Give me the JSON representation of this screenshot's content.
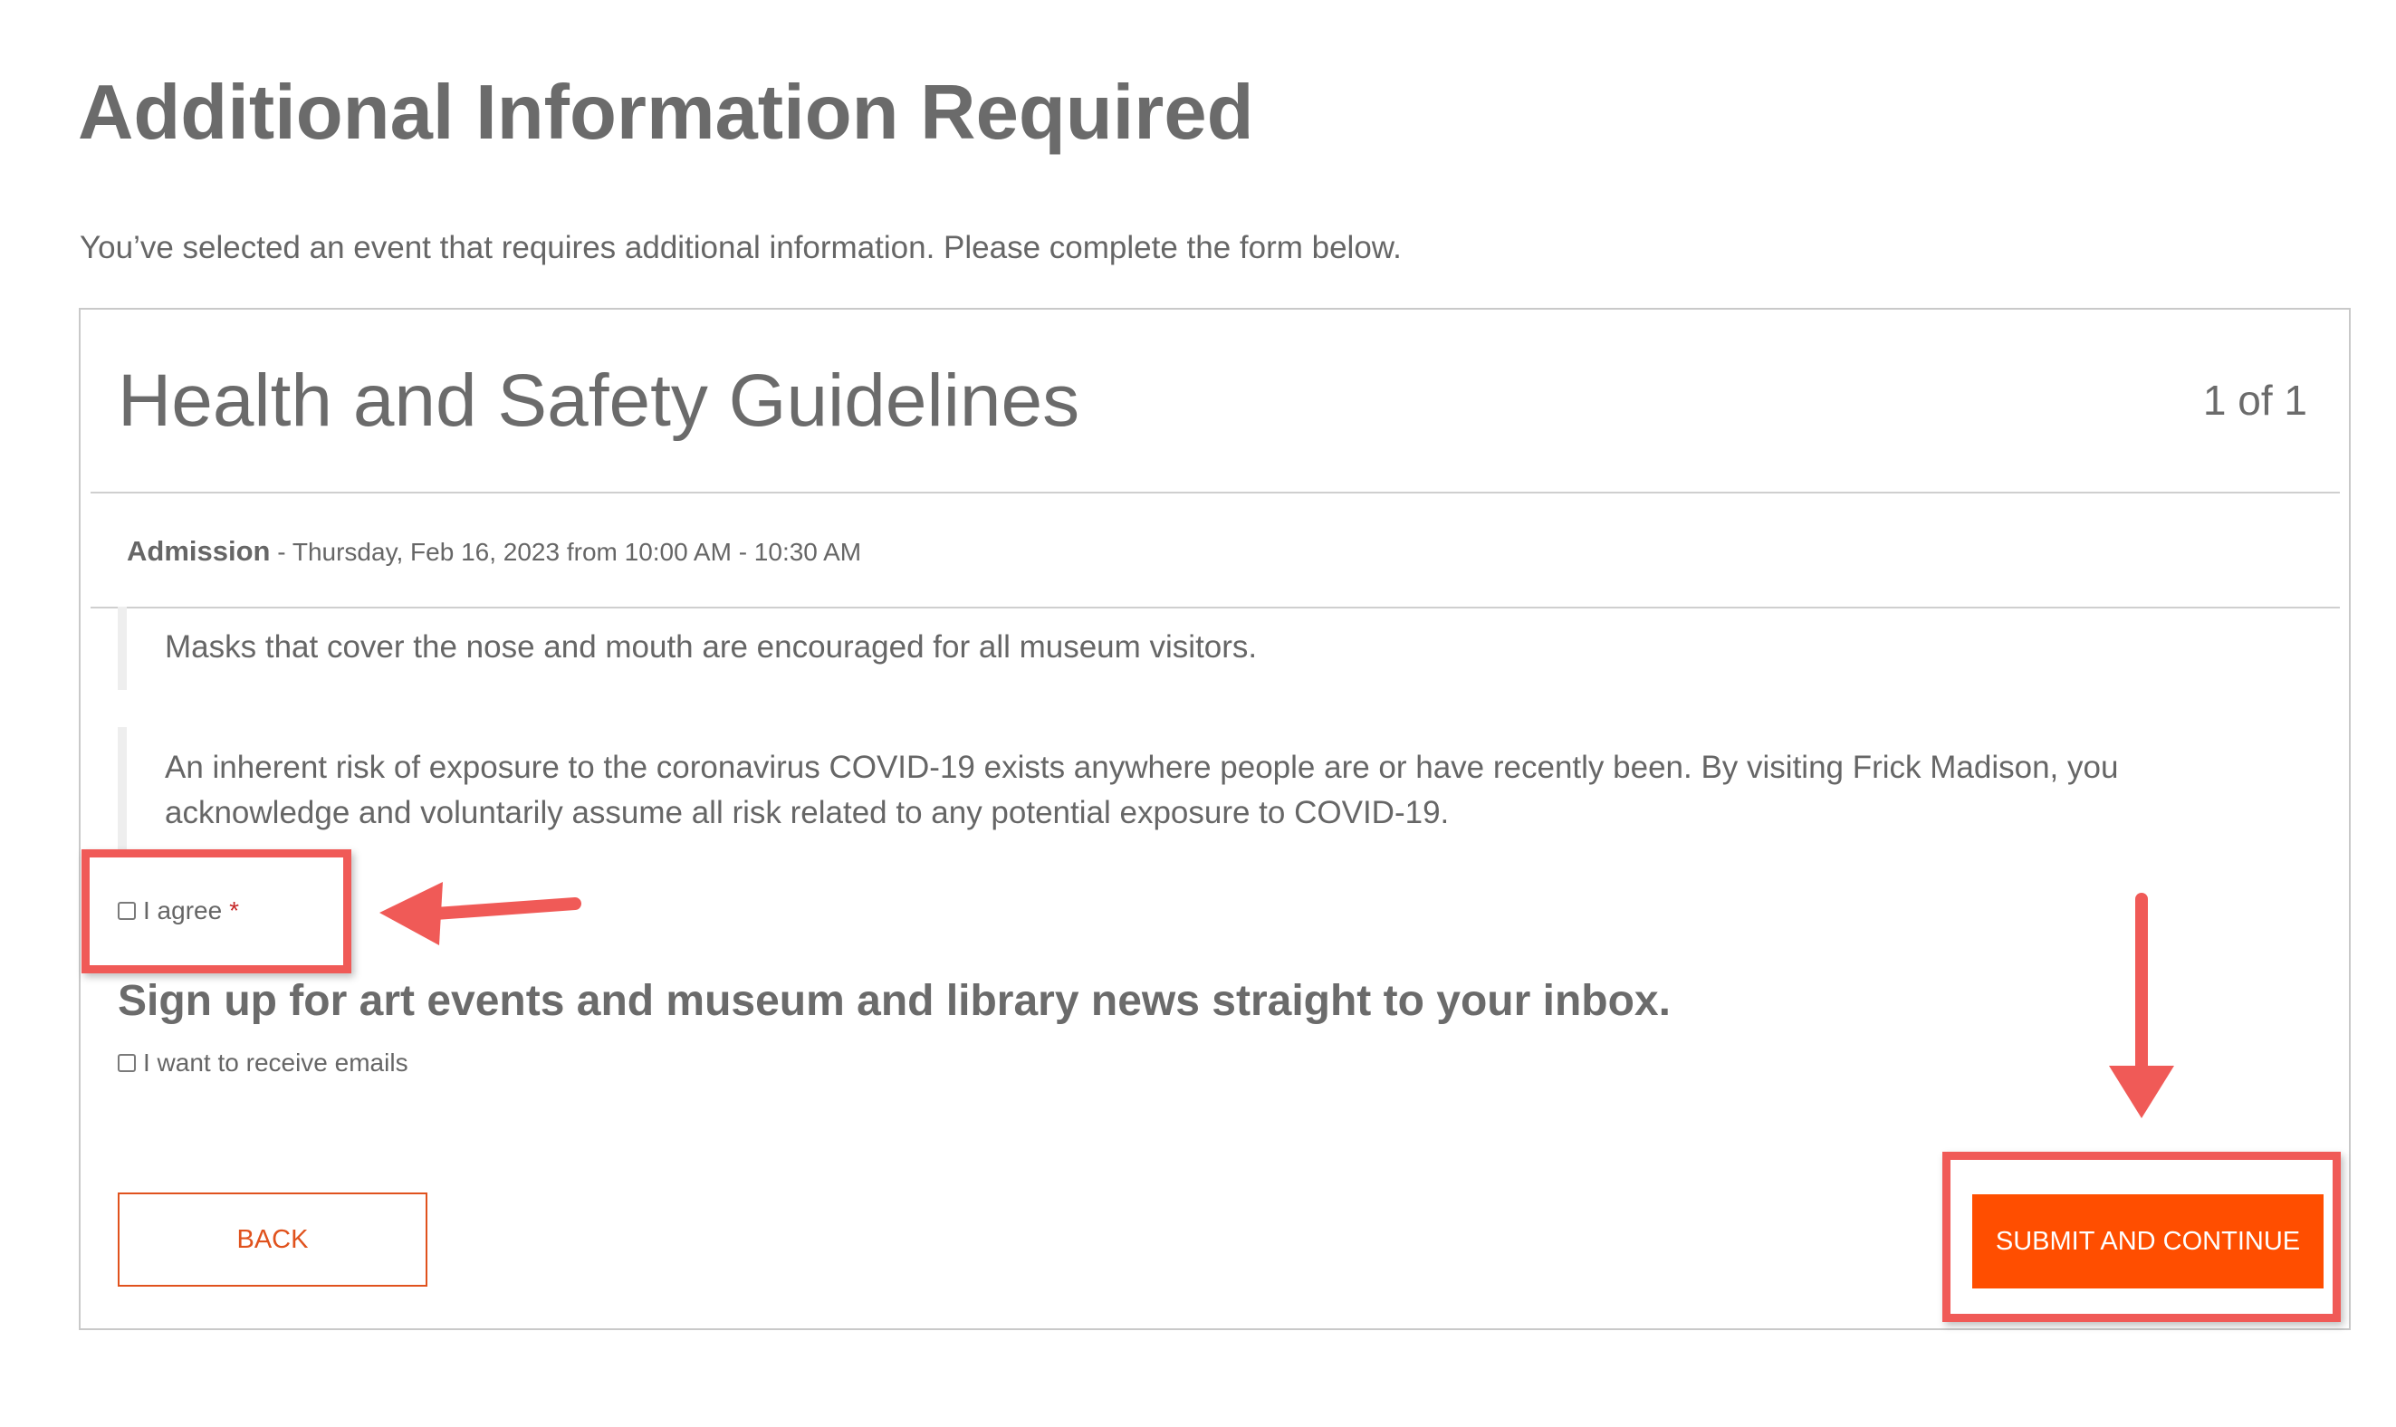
{
  "page": {
    "title": "Additional Information Required",
    "intro": "You’ve selected an event that requires additional information. Please complete the form below."
  },
  "panel": {
    "title": "Health and Safety Guidelines",
    "counter": "1 of 1",
    "event": {
      "name": "Admission",
      "details": "- Thursday, Feb 16, 2023 from 10:00 AM - 10:30 AM"
    },
    "notices": [
      "Masks that cover the nose and mouth are encouraged for all museum visitors.",
      "An inherent risk of exposure to the coronavirus COVID-19 exists anywhere people are or have recently been. By visiting Frick Madison, you acknowledge and voluntarily assume all risk related to any potential exposure to COVID-19."
    ],
    "agree": {
      "label": "I agree",
      "required_mark": "*",
      "checked": false
    },
    "signup": {
      "heading": "Sign up for art events and museum and library news straight to your inbox.",
      "label": "I want to receive emails",
      "checked": false
    },
    "buttons": {
      "back": "BACK",
      "submit": "SUBMIT AND CONTINUE"
    }
  },
  "colors": {
    "accent_orange": "#ff4e00",
    "annotation_red": "#f05a57",
    "text_gray": "#666666",
    "border_gray": "#c9c9c9"
  },
  "annotations": {
    "icons": [
      "arrow-left-icon",
      "arrow-down-icon"
    ]
  }
}
